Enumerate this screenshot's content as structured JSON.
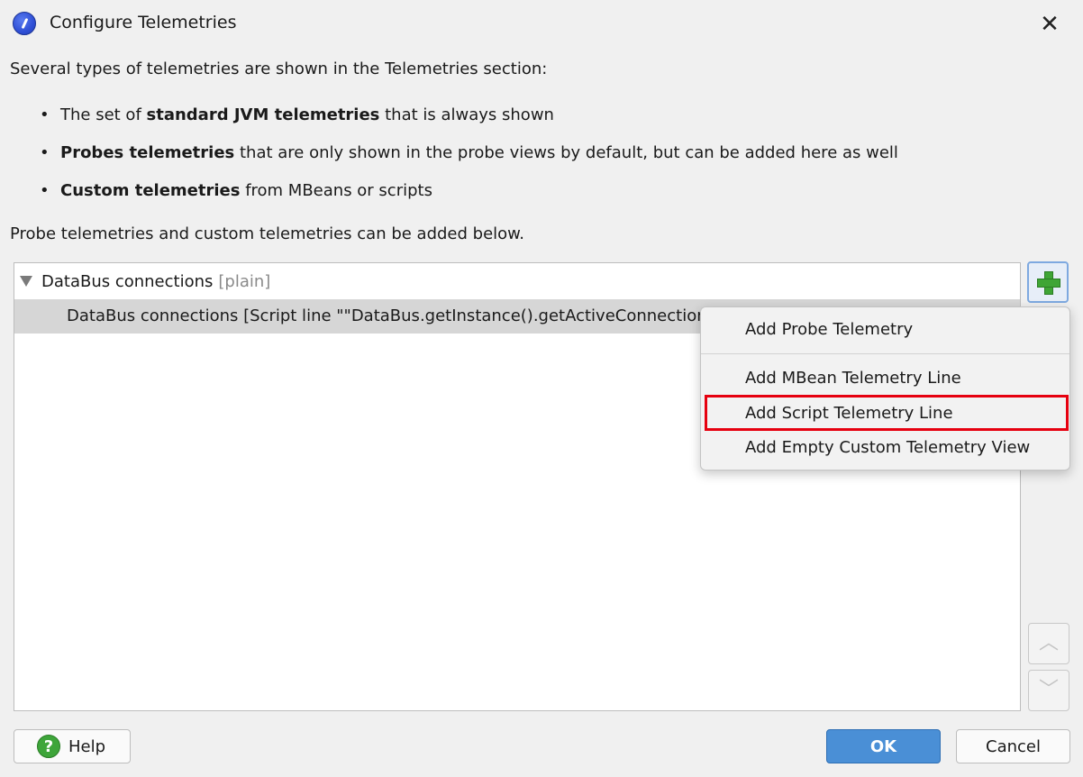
{
  "window": {
    "title": "Configure Telemetries",
    "icon": "jprofiler-app-icon",
    "close_glyph": "✕"
  },
  "description": {
    "intro": "Several types of telemetries are shown in the Telemetries section:",
    "bullets": [
      {
        "pre": "The set of ",
        "bold": "standard JVM telemetries",
        "post": " that is always shown"
      },
      {
        "pre": "",
        "bold": "Probes telemetries",
        "post": " that are only shown in the probe views by default, but can be added here as well"
      },
      {
        "pre": "",
        "bold": "Custom telemetries",
        "post": " from MBeans or scripts"
      }
    ],
    "below": "Probe telemetries and custom telemetries can be added below."
  },
  "tree": {
    "group": {
      "label": "DataBus connections",
      "tag": "[plain]",
      "expanded": true
    },
    "child": {
      "label": "DataBus connections [Script line \"\"DataBus.getInstance().getActiveConnections()\"\"]"
    }
  },
  "popup_menu": {
    "items": [
      {
        "label": "Add Probe Telemetry"
      },
      {
        "label": "Add MBean Telemetry Line"
      },
      {
        "label": "Add Script Telemetry Line",
        "highlighted": true
      },
      {
        "label": "Add Empty Custom Telemetry View"
      }
    ]
  },
  "side_buttons": {
    "add_icon": "plus-icon",
    "up_icon": "chevron-up-icon",
    "down_icon": "chevron-down-icon",
    "up_glyph": "︿",
    "down_glyph": "﹀"
  },
  "footer": {
    "help_label": "Help",
    "help_glyph": "?",
    "ok_label": "OK",
    "cancel_label": "Cancel"
  },
  "colors": {
    "accent": "#4a8fd6",
    "highlight": "#e6000f",
    "add_green": "#3fa535"
  }
}
